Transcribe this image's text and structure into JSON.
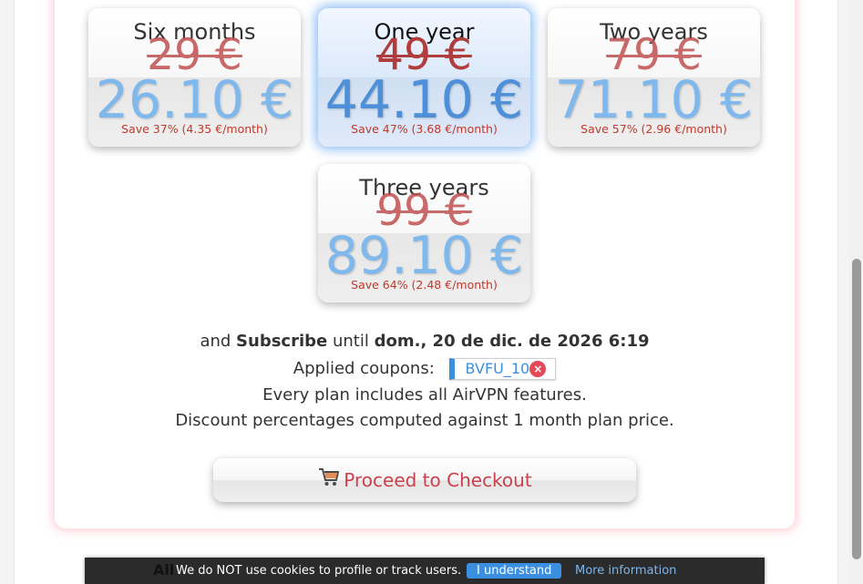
{
  "plans": [
    {
      "name": "Six months",
      "old_price": "29 €",
      "new_price": "26.10 €",
      "save": "Save 37% (4.35 €/month)",
      "selected": false
    },
    {
      "name": "One year",
      "old_price": "49 €",
      "new_price": "44.10 €",
      "save": "Save 47% (3.68 €/month)",
      "selected": true
    },
    {
      "name": "Two years",
      "old_price": "79 €",
      "new_price": "71.10 €",
      "save": "Save 57% (2.96 €/month)",
      "selected": false
    },
    {
      "name": "Three years",
      "old_price": "99 €",
      "new_price": "89.10 €",
      "save": "Save 64% (2.48 €/month)",
      "selected": false
    }
  ],
  "subscribe": {
    "prefix": "and",
    "action": "Subscribe",
    "until": "until",
    "date": "dom., 20 de dic. de 2026 6:19"
  },
  "coupons": {
    "label": "Applied coupons:",
    "code": "BVFU_10",
    "remove_glyph": "×"
  },
  "notes": {
    "features": "Every plan includes all AirVPN features.",
    "discount": "Discount percentages computed against 1 month plan price."
  },
  "checkout": {
    "label": "Proceed to Checkout",
    "icon": "shopping-cart-icon"
  },
  "cookie_bar": {
    "behind_text": "All",
    "text": "We do NOT use cookies to profile or track users.",
    "accept": "I understand",
    "more": "More information"
  },
  "colors": {
    "accent_blue": "#3b8fe0",
    "price_blue": "#7fb8ec",
    "strike_red": "#c05050",
    "checkout_red": "#c9414e",
    "panel_glow": "#ffaab9"
  }
}
